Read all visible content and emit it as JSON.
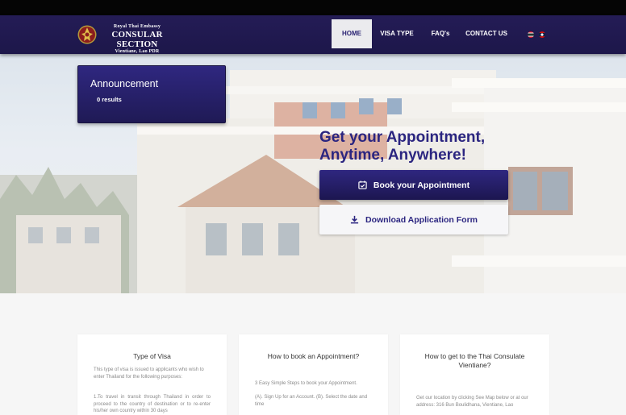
{
  "brand": {
    "line1": "Royal Thai Embassy",
    "line2": "CONSULAR SECTION",
    "line3": "Vientiane, Lao PDR"
  },
  "nav": {
    "items": [
      {
        "label": "HOME",
        "active": true
      },
      {
        "label": "VISA TYPE",
        "active": false
      },
      {
        "label": "FAQ's",
        "active": false
      },
      {
        "label": "CONTACT US",
        "active": false
      }
    ],
    "languages": [
      "Thai",
      "Lao"
    ]
  },
  "announcement": {
    "title": "Announcement",
    "count": "0 results"
  },
  "hero": {
    "headline_line1": "Get your Appointment,",
    "headline_line2": "Anytime, Anywhere!",
    "book_button": "Book your Appointment",
    "download_button": "Download Application Form"
  },
  "cards": [
    {
      "title": "Type of Visa",
      "text": "This type of visa is issued to applicants who wish to enter Thailand for the following purposes:",
      "text2": "1.To travel in transit through Thailand in order to proceed to the country of destination or to re-enter his/her own country within 30 days"
    },
    {
      "title": "How to book an Appointment?",
      "text": "3 Easy Simple Steps to book your Appointment.",
      "text2": "(A). Sign Up for an Account. (B). Select the date and time"
    },
    {
      "title": "How to get to the Thai Consulate Vientiane?",
      "text": "Get our location by clicking See Map below or at our address: 316 Bun Boulidhana, Vientiane, Lao"
    }
  ],
  "colors": {
    "primary": "#2b2580",
    "navbar": "#1f1a4e",
    "active_nav_bg": "#ebebee"
  }
}
